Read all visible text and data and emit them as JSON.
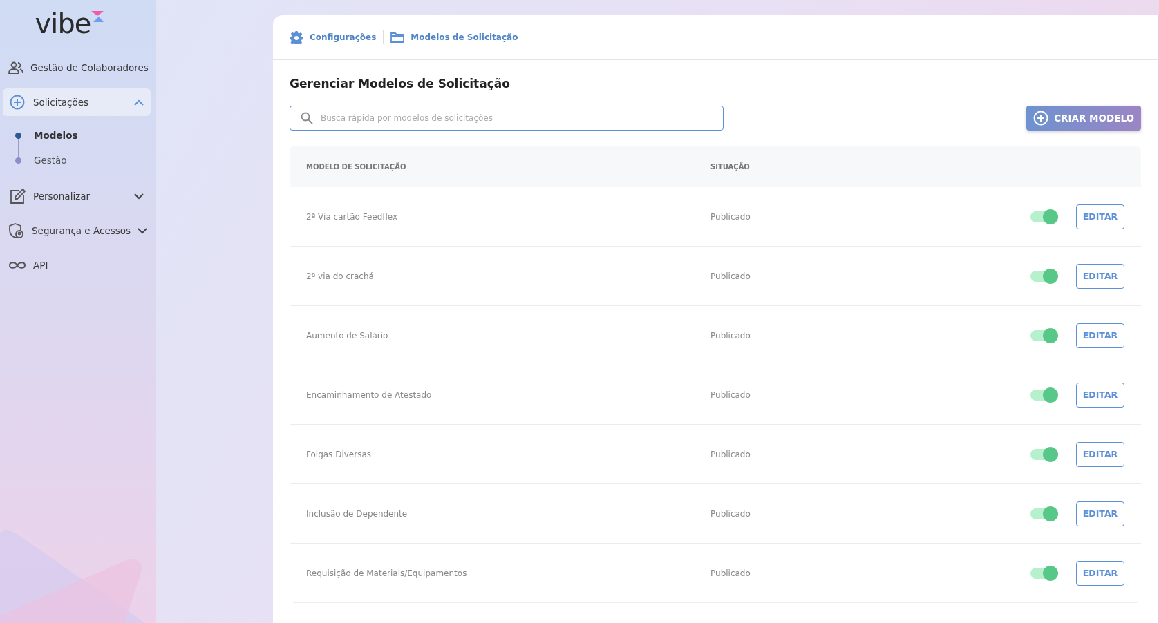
{
  "sidebar": {
    "logo": "vibe",
    "items": [
      {
        "label": "Gestão de Colaboradores",
        "kind": "people",
        "selected": false
      },
      {
        "label": "Solicitações",
        "kind": "plus",
        "selected": true,
        "expanded": true,
        "children": [
          {
            "label": "Modelos",
            "selected": true
          },
          {
            "label": "Gestão",
            "selected": false
          }
        ]
      },
      {
        "label": "Personalizar",
        "kind": "edit",
        "selected": false,
        "expanded": false
      },
      {
        "label": "Segurança e Acessos",
        "kind": "shield",
        "selected": false,
        "expanded": false
      },
      {
        "label": "API",
        "kind": "infinity",
        "selected": false
      }
    ]
  },
  "breadcrumb": [
    {
      "label": "Configurações",
      "kind": "settings"
    },
    {
      "label": "Modelos de Solicitação",
      "kind": "folder"
    }
  ],
  "title": "Gerenciar Modelos de Solicitação",
  "search": {
    "placeholder": "Busca rápida por modelos de solicitações"
  },
  "create_button": "CRIAR MODELO",
  "table": {
    "columns": [
      "MODELO DE SOLICITAÇÃO",
      "SITUAÇÃO"
    ],
    "rows": [
      {
        "name": "2ª Via cartão Feedflex",
        "status": "Publicado",
        "on": true,
        "action": "EDITAR"
      },
      {
        "name": "2ª via do crachá",
        "status": "Publicado",
        "on": true,
        "action": "EDITAR"
      },
      {
        "name": "Aumento de Salário",
        "status": "Publicado",
        "on": true,
        "action": "EDITAR"
      },
      {
        "name": "Encaminhamento de Atestado",
        "status": "Publicado",
        "on": true,
        "action": "EDITAR"
      },
      {
        "name": "Folgas Diversas",
        "status": "Publicado",
        "on": true,
        "action": "EDITAR"
      },
      {
        "name": "Inclusão de Dependente",
        "status": "Publicado",
        "on": true,
        "action": "EDITAR"
      },
      {
        "name": "Requisição de Materiais/Equipamentos",
        "status": "Publicado",
        "on": true,
        "action": "EDITAR"
      }
    ]
  }
}
